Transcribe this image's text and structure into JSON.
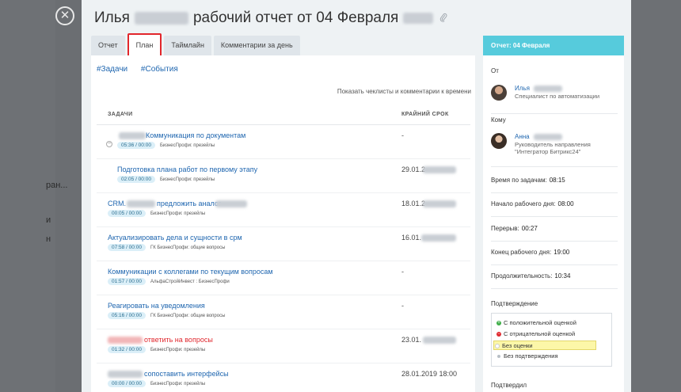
{
  "background": {
    "fragments": [
      "ран...",
      "и",
      "н"
    ]
  },
  "close_glyph": "✕",
  "header": {
    "title_left": "Илья",
    "title_right": "рабочий отчет от 04 Февраля",
    "pin_icon": "paperclip-icon"
  },
  "tabs": [
    {
      "label": "Отчет",
      "active": false
    },
    {
      "label": "План",
      "active": true
    },
    {
      "label": "Таймлайн",
      "active": false
    },
    {
      "label": "Комментарии за день",
      "active": false
    }
  ],
  "filters": [
    "#Задачи",
    "#События"
  ],
  "hint": "Показать чеклисты и комментарии к времени",
  "table": {
    "col_tasks": "ЗАДАЧИ",
    "col_deadline": "КРАЙНИЙ СРОК",
    "rows": [
      {
        "name": "Коммуникация по документам",
        "time": "05:36 / 00:00",
        "project": "БизнесПрофи: презейлы",
        "deadline": "-",
        "red": false
      },
      {
        "name": "Подготовка плана работ по первому этапу",
        "time": "02:05 / 00:00",
        "project": "БизнесПрофи: презейлы",
        "deadline": "29.01.2",
        "red": false
      },
      {
        "name": "CRM.",
        "name2": "предложить аналог",
        "time": "00:05 / 00:00",
        "project": "БизнесПрофи: презейлы",
        "deadline": "18.01.2",
        "red": false
      },
      {
        "name": "Актуализировать дела и сущности в срм",
        "time": "07:58 / 00:00",
        "project": "ГК БизнесПрофи: общие вопросы",
        "deadline": "16.01.",
        "red": false
      },
      {
        "name": "Коммуникации с коллегами по текущим вопросам",
        "time": "01:57 / 00:00",
        "project": "АльфаСтройИнвест : БизнесПрофи",
        "deadline": "-",
        "red": false
      },
      {
        "name": "Реагировать на уведомления",
        "time": "05:16 / 00:00",
        "project": "ГК БизнесПрофи: общие вопросы",
        "deadline": "-",
        "red": false
      },
      {
        "name": "ответить на вопросы",
        "time": "01:32 / 00:00",
        "project": "БизнесПрофи: презейлы",
        "deadline": "23.01.",
        "red": true
      },
      {
        "name": "сопоставить интерфейсы",
        "time": "00:00 / 00:00",
        "project": "БизнесПрофи: презейлы",
        "deadline": "28.01.2019 18:00",
        "red": false
      }
    ]
  },
  "side": {
    "header": "Отчет: 04 Февраля",
    "from_label": "От",
    "from": {
      "name": "Илья",
      "role": "Специалист по автоматизации"
    },
    "to_label": "Кому",
    "to": {
      "name": "Анна",
      "role_line1": "Руководитель направления",
      "role_line2": "\"Интегратор Битрикс24\""
    },
    "time_tasks": {
      "label": "Время по задачам:",
      "value": "08:15"
    },
    "start": {
      "label": "Начало рабочего дня:",
      "value": "08:00"
    },
    "break": {
      "label": "Перерыв:",
      "value": "00:27"
    },
    "end": {
      "label": "Конец рабочего дня:",
      "value": "19:00"
    },
    "duration": {
      "label": "Продолжительность:",
      "value": "10:34"
    },
    "confirmation_label": "Подтверждение",
    "options": [
      "С положительной оценкой",
      "С отрицательной оценкой",
      "Без оценки",
      "Без подтверждения"
    ],
    "confirmed_label": "Подтвердил",
    "colors": {
      "positive": "#3fae49",
      "negative": "#e0282e",
      "none": "#ffffff",
      "unconfirmed": "#b8bfc6"
    }
  }
}
